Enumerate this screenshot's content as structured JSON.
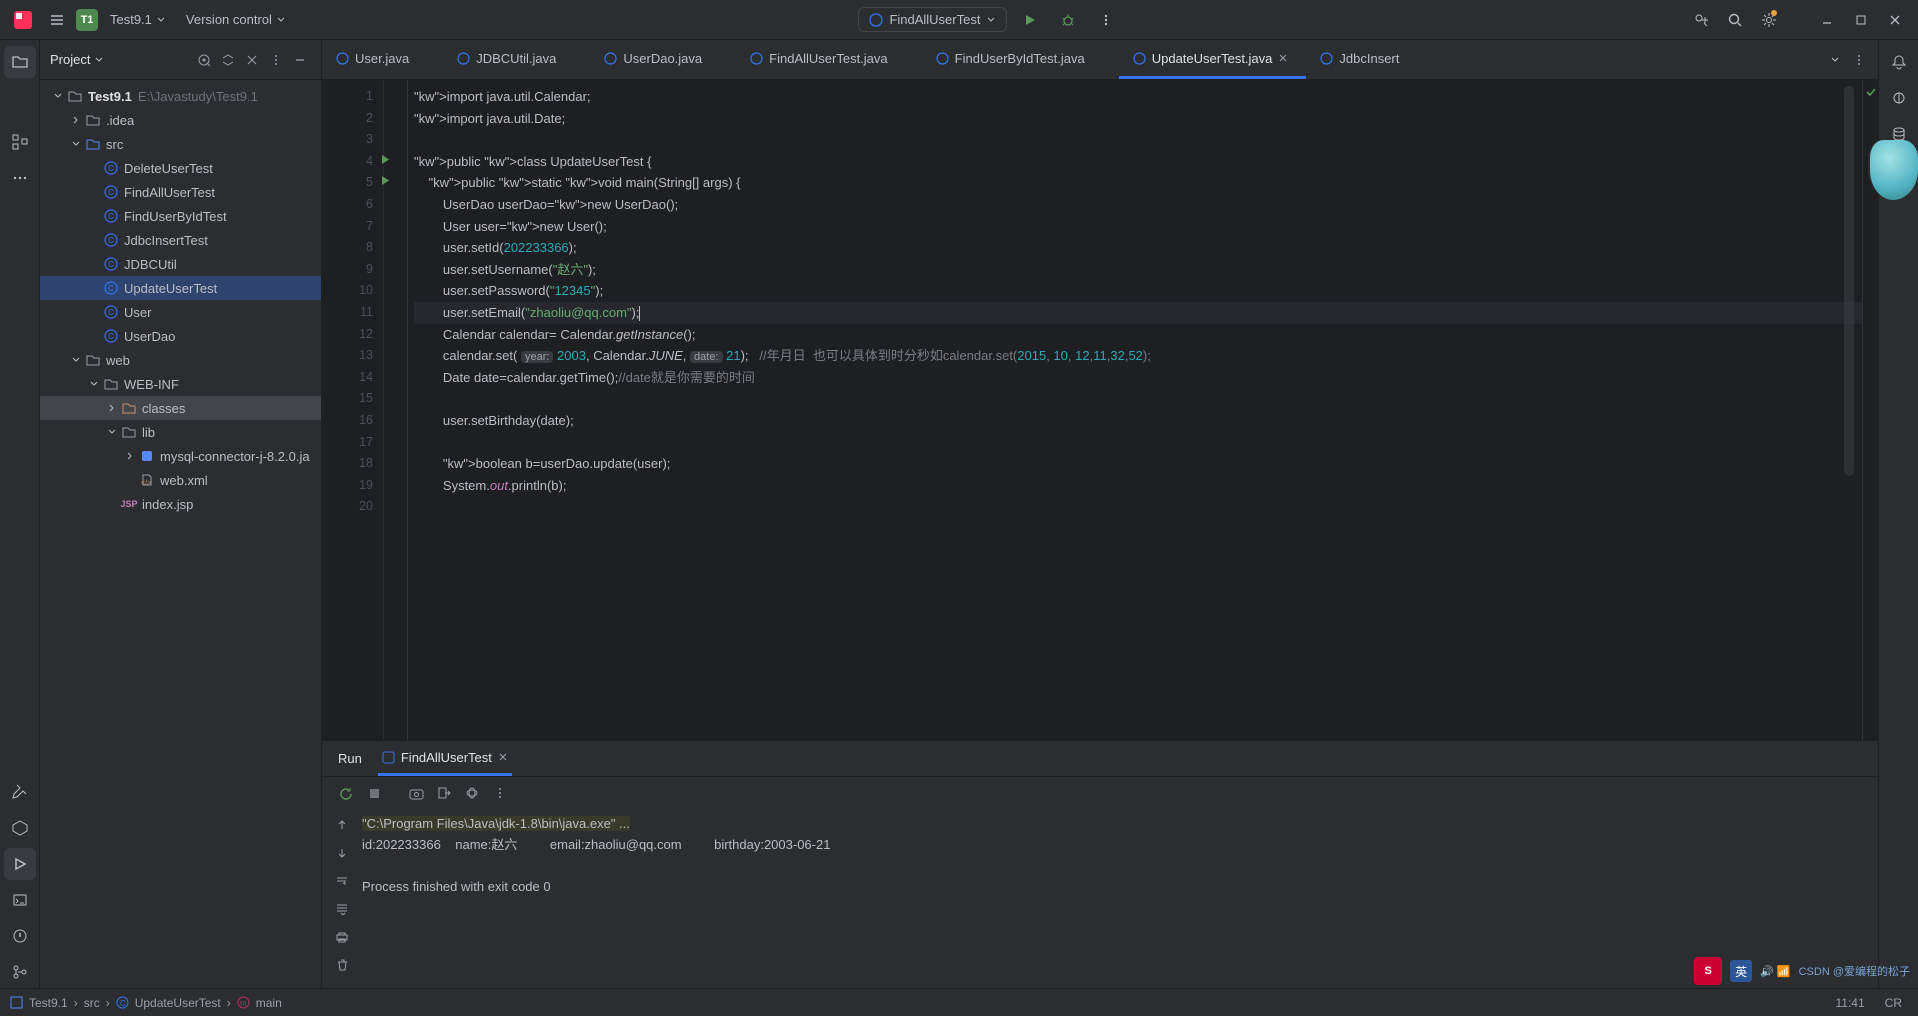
{
  "titlebar": {
    "project_badge": "T1",
    "project": "Test9.1",
    "vcs": "Version control",
    "run_config": "FindAllUserTest"
  },
  "project_panel": {
    "title": "Project",
    "root": {
      "name": "Test9.1",
      "path": "E:\\Javastudy\\Test9.1"
    },
    "idea": ".idea",
    "src": "src",
    "src_files": [
      "DeleteUserTest",
      "FindAllUserTest",
      "FindUserByIdTest",
      "JdbcInsertTest",
      "JDBCUtil",
      "UpdateUserTest",
      "User",
      "UserDao"
    ],
    "web": "web",
    "webinf": "WEB-INF",
    "classes": "classes",
    "lib": "lib",
    "jar": "mysql-connector-j-8.2.0.ja",
    "webxml": "web.xml",
    "indexjsp": "index.jsp"
  },
  "tabs": [
    "User.java",
    "JDBCUtil.java",
    "UserDao.java",
    "FindAllUserTest.java",
    "FindUserByIdTest.java",
    "UpdateUserTest.java",
    "JdbcInsert"
  ],
  "active_tab_index": 5,
  "editor": {
    "lines": [
      "import java.util.Calendar;",
      "import java.util.Date;",
      "",
      "public class UpdateUserTest {",
      "    public static void main(String[] args) {",
      "        UserDao userDao=new UserDao();",
      "        User user=new User();",
      "        user.setId(202233366);",
      "        user.setUsername(\"赵六\");",
      "        user.setPassword(\"12345\");",
      "        user.setEmail(\"zhaoliu@qq.com\");",
      "        Calendar calendar= Calendar.getInstance();",
      "        calendar.set( year: 2003, Calendar.JUNE, date: 21);   //年月日  也可以具体到时分秒如calendar.set(2015, 10, 12,11,32,52);",
      "        Date date=calendar.getTime();//date就是你需要的时间",
      "",
      "        user.setBirthday(date);",
      "",
      "        boolean b=userDao.update(user);",
      "        System.out.println(b);",
      ""
    ],
    "current_line": 11
  },
  "run": {
    "title": "Run",
    "tab": "FindAllUserTest",
    "output": [
      "\"C:\\Program Files\\Java\\jdk-1.8\\bin\\java.exe\" ...",
      "id:202233366    name:赵六         email:zhaoliu@qq.com         birthday:2003-06-21",
      "",
      "Process finished with exit code 0"
    ]
  },
  "breadcrumb": [
    "Test9.1",
    "src",
    "UpdateUserTest",
    "main"
  ],
  "status": {
    "time": "11:41",
    "enc": "CR"
  },
  "watermark": "CSDN @爱编程的松子"
}
